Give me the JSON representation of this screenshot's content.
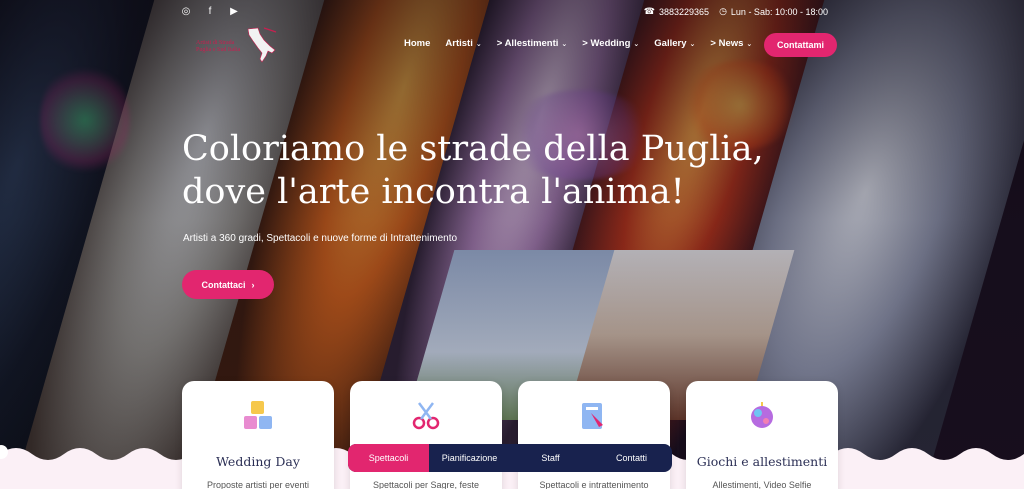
{
  "social": {
    "icons": [
      "instagram-icon",
      "facebook-icon",
      "youtube-icon"
    ],
    "glyphs": [
      "◎",
      "f",
      "▶"
    ]
  },
  "contact": {
    "phone": "3883229365",
    "phone_icon": "☎",
    "hours": "Lun - Sab: 10:00 - 18:00",
    "hours_icon": "◷"
  },
  "logo": {
    "line1": "Artisti di Strada",
    "line2": "Puglia e Sud Italia"
  },
  "nav": {
    "items": [
      {
        "label": "Home",
        "chevron": ""
      },
      {
        "label": "Artisti",
        "chevron": "⌄"
      },
      {
        "label": "> Allestimenti",
        "chevron": "⌄"
      },
      {
        "label": "> Wedding",
        "chevron": "⌄"
      },
      {
        "label": "Gallery",
        "chevron": "⌄"
      },
      {
        "label": "> News",
        "chevron": "⌄"
      }
    ],
    "search_icon": "⌕",
    "cta": "Contattami"
  },
  "hero": {
    "headline_1": "Coloriamo le strade della Puglia,",
    "headline_2": "dove l'arte incontra l'anima!",
    "subline": "Artisti a 360 gradi, Spettacoli e nuove forme di Intrattenimento",
    "cta": "Contattaci",
    "cta_arrow": "›"
  },
  "cards": [
    {
      "title": "Wedding Day",
      "desc": "Proposte artisti per eventi"
    },
    {
      "title": "",
      "desc": "Spettacoli per Sagre, feste"
    },
    {
      "title": "",
      "desc": "Spettacoli e intrattenimento"
    },
    {
      "title": "Giochi e allestimenti",
      "desc": "Allestimenti, Video Selfie"
    }
  ],
  "tabs": [
    {
      "label": "Spettacoli",
      "active": true
    },
    {
      "label": "Pianificazione",
      "active": false
    },
    {
      "label": "Staff",
      "active": false
    },
    {
      "label": "Contatti",
      "active": false
    }
  ],
  "colors": {
    "accent": "#e2266f",
    "navy": "#18224e",
    "title": "#2b2f55"
  }
}
